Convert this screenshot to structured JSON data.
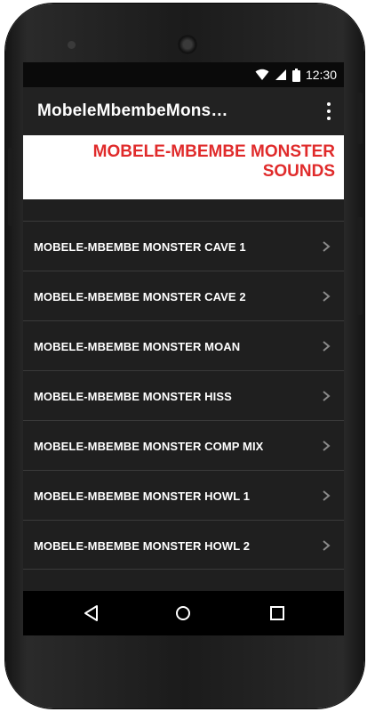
{
  "status": {
    "time": "12:30"
  },
  "app": {
    "title": "MobeleMbembeMons…"
  },
  "banner": {
    "text": "MOBELE-MBEMBE MONSTER SOUNDS"
  },
  "list": {
    "items": [
      {
        "label": "MOBELE-MBEMBE MONSTER CAVE 1"
      },
      {
        "label": "MOBELE-MBEMBE MONSTER CAVE 2"
      },
      {
        "label": "MOBELE-MBEMBE MONSTER MOAN"
      },
      {
        "label": "MOBELE-MBEMBE MONSTER HISS"
      },
      {
        "label": "MOBELE-MBEMBE MONSTER COMP MIX"
      },
      {
        "label": "MOBELE-MBEMBE MONSTER HOWL 1"
      },
      {
        "label": "MOBELE-MBEMBE MONSTER HOWL 2"
      }
    ]
  },
  "icons": {
    "wifi": "wifi-icon",
    "signal": "signal-icon",
    "battery": "battery-icon",
    "overflow": "overflow-menu-icon",
    "chevron": "chevron-right-icon",
    "back": "back-icon",
    "home": "home-icon",
    "recents": "recents-icon"
  },
  "colors": {
    "banner_text": "#e02b2b",
    "background": "#1f1f1f",
    "appbar": "#222222"
  }
}
